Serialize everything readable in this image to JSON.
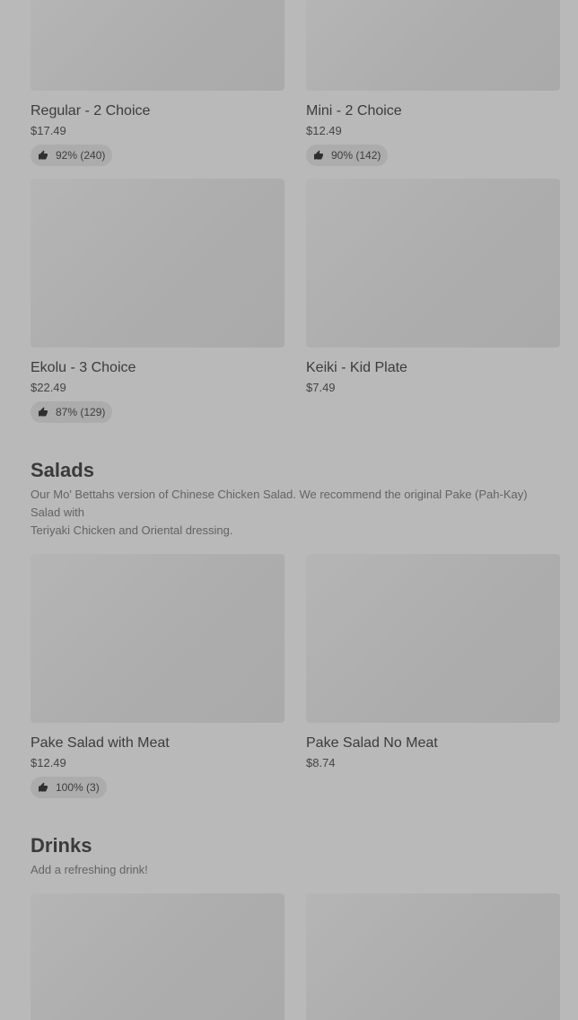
{
  "sections": {
    "platters": {
      "items": [
        {
          "title": "Regular - 2 Choice",
          "price": "$17.49",
          "rating": "92% (240)"
        },
        {
          "title": "Mini - 2 Choice",
          "price": "$12.49",
          "rating": "90% (142)"
        },
        {
          "title": "Ekolu - 3 Choice",
          "price": "$22.49",
          "rating": "87% (129)"
        },
        {
          "title": "Keiki - Kid Plate",
          "price": "$7.49"
        }
      ]
    },
    "salads": {
      "title": "Salads",
      "description_line1": "Our Mo' Bettahs version of Chinese Chicken Salad. We recommend the original Pake (Pah-Kay) Salad with",
      "description_line2": "Teriyaki Chicken and Oriental dressing.",
      "items": [
        {
          "title": "Pake Salad with Meat",
          "price": "$12.49",
          "rating": "100% (3)"
        },
        {
          "title": "Pake Salad No Meat",
          "price": "$8.74"
        }
      ]
    },
    "drinks": {
      "title": "Drinks",
      "description": "Add a refreshing drink!"
    }
  },
  "icons": {
    "rating": "thumbs-up-icon"
  },
  "colors": {
    "background": "#b9b9b9",
    "image_placeholder": "#adadad",
    "rating_pill": "#acacac"
  }
}
